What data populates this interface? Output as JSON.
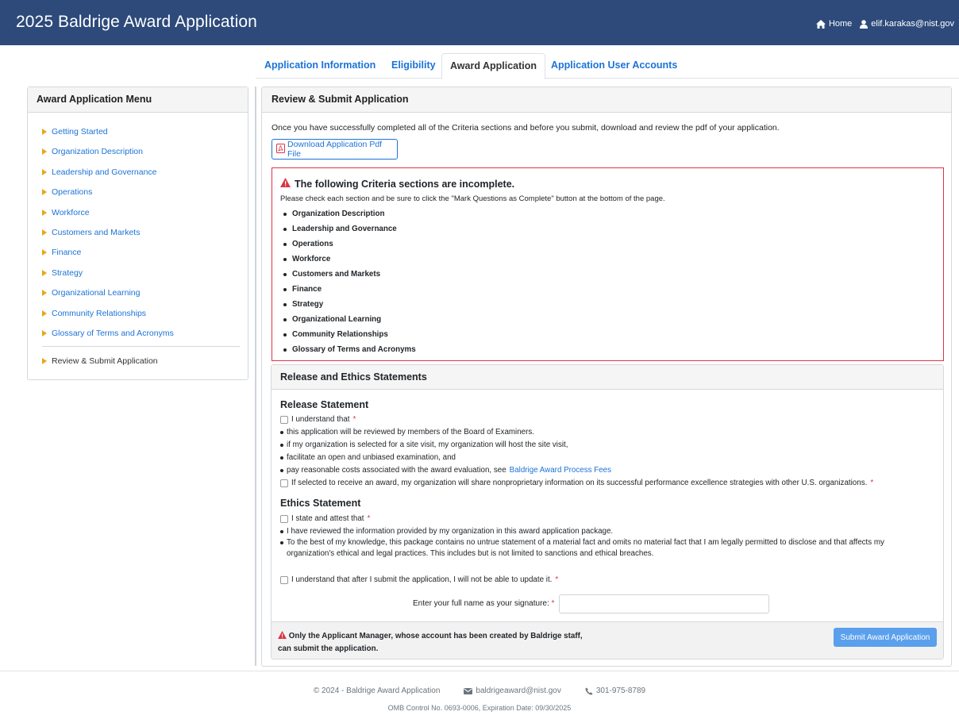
{
  "header": {
    "title": "2025 Baldrige Award Application",
    "home_label": "Home",
    "user_email": "elif.karakas@nist.gov"
  },
  "tabs": [
    {
      "label": "Application Information"
    },
    {
      "label": "Eligibility"
    },
    {
      "label": "Award Application",
      "active": true
    },
    {
      "label": "Application User Accounts"
    }
  ],
  "sidebar": {
    "title": "Award Application Menu",
    "items": [
      {
        "label": "Getting Started"
      },
      {
        "label": "Organization Description"
      },
      {
        "label": "Leadership and Governance"
      },
      {
        "label": "Operations"
      },
      {
        "label": "Workforce"
      },
      {
        "label": "Customers and Markets"
      },
      {
        "label": "Finance"
      },
      {
        "label": "Strategy"
      },
      {
        "label": "Organizational Learning"
      },
      {
        "label": "Community Relationships"
      },
      {
        "label": "Glossary of Terms and Acronyms"
      }
    ],
    "current_item": "Review & Submit Application"
  },
  "main": {
    "title": "Review & Submit Application",
    "intro": "Once you have successfully completed all of the Criteria sections and before you submit, download and review the pdf of your application.",
    "download_label": "Download Application Pdf File",
    "alert": {
      "title": "The following Criteria sections are incomplete.",
      "subtitle": "Please check each section and be sure to click the \"Mark Questions as Complete\" button at the bottom of the page.",
      "sections": [
        "Organization Description",
        "Leadership and Governance",
        "Operations",
        "Workforce",
        "Customers and Markets",
        "Finance",
        "Strategy",
        "Organizational Learning",
        "Community Relationships",
        "Glossary of Terms and Acronyms"
      ]
    }
  },
  "release": {
    "title": "Release and Ethics Statements",
    "release_heading": "Release Statement",
    "release_check": "I understand that",
    "release_bullets": [
      "this application will be reviewed by members of the Board of Examiners.",
      "if my organization is selected for a site visit, my organization will host the site visit,",
      "facilitate an open and unbiased examination, and"
    ],
    "fees_prefix": "pay reasonable costs associated with the award evaluation, see",
    "fees_link": "Baldrige Award Process Fees",
    "share_check": "If selected to receive an award, my organization will share nonproprietary information on its successful performance excellence strategies with other U.S. organizations.",
    "ethics_heading": "Ethics Statement",
    "ethics_check": "I state and attest that",
    "ethics_bullets": [
      "I have reviewed the information provided by my organization in this award application package.",
      "To the best of my knowledge, this package contains no untrue statement of a material fact and omits no material fact that I am legally permitted to disclose and that affects my organization's ethical and legal practices. This includes but is not limited to sanctions and ethical breaches."
    ],
    "update_check": "I understand that after I submit the application, I will not be able to update it.",
    "required_mark": "*",
    "signature_label": "Enter your full name as your signature:",
    "signature_value": "",
    "warning_line1": "Only the Applicant Manager, whose account has been created by Baldrige staff,",
    "warning_line2": "can submit the application.",
    "submit_label": "Submit Award Application"
  },
  "footer": {
    "copyright": "© 2024 - Baldrige Award Application",
    "email": "baldrigeaward@nist.gov",
    "phone": "301-975-8789",
    "omb": "OMB Control No. 0693-0006, Expiration Date: 09/30/2025"
  },
  "colors": {
    "header_bg": "#2d4a7b",
    "link": "#1b73d6",
    "alert_border": "#dc3545",
    "caret": "#e6a817",
    "submit_bg": "#5aa0ec"
  }
}
